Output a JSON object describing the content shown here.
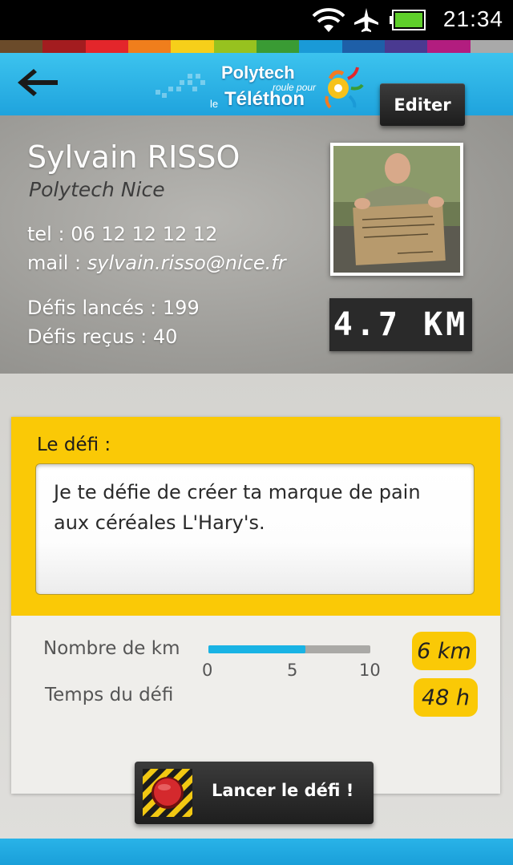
{
  "status_bar": {
    "time": "21:34",
    "icons": [
      "wifi-icon",
      "airplane-icon",
      "battery-icon"
    ]
  },
  "color_strip": [
    "#6b4b2a",
    "#a31c1f",
    "#e3262b",
    "#f07e1c",
    "#f6cf1a",
    "#97c21f",
    "#3a9b34",
    "#1a9ad7",
    "#1e5fa8",
    "#4a3a91",
    "#b21d7f",
    "#a9a9a9"
  ],
  "header": {
    "logo_line1": "Polytech",
    "logo_line2": "roule pour",
    "logo_line3a": "le",
    "logo_line3b": "Téléthon",
    "edit_label": "Editer"
  },
  "profile": {
    "name": "Sylvain RISSO",
    "school": "Polytech Nice",
    "tel_label": "tel :",
    "tel": "06 12 12 12 12",
    "mail_label": "mail :",
    "mail": "sylvain.risso@nice.fr",
    "defis_lances_label": "Défis lancés :",
    "defis_lances": "199",
    "defis_recus_label": "Défis reçus :",
    "defis_recus": "40",
    "distance": "4.7 KM"
  },
  "defi": {
    "label": "Le défi :",
    "text": "Je te défie de créer ta marque de pain aux céréales L'Hary's."
  },
  "params": {
    "km_label": "Nombre de km",
    "time_label": "Temps du défi",
    "slider_min": "0",
    "slider_mid": "5",
    "slider_max": "10",
    "slider_value": 6,
    "slider_range": [
      0,
      10
    ],
    "km_value": "6 km",
    "time_value": "48 h"
  },
  "launch_button": {
    "label": "Lancer le défi !"
  },
  "colors": {
    "accent_yellow": "#fac906",
    "accent_blue": "#1fa3dd",
    "slider_blue": "#19b3e4"
  }
}
